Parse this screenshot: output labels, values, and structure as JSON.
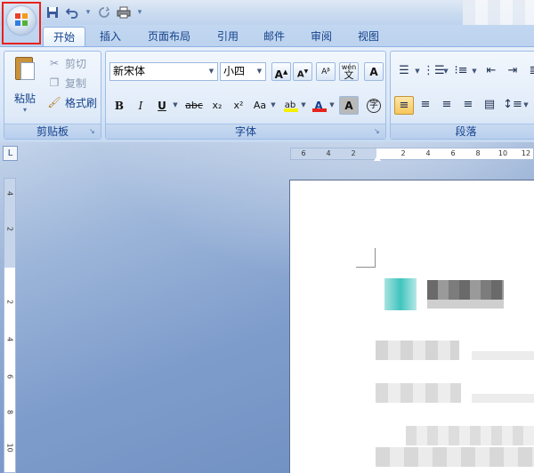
{
  "qat": {
    "icons": [
      "save-icon",
      "undo-icon",
      "redo-icon",
      "print-icon",
      "customize-icon"
    ]
  },
  "tabs": [
    {
      "label": "开始",
      "active": true
    },
    {
      "label": "插入"
    },
    {
      "label": "页面布局"
    },
    {
      "label": "引用"
    },
    {
      "label": "邮件"
    },
    {
      "label": "审阅"
    },
    {
      "label": "视图"
    }
  ],
  "clipboard": {
    "label": "剪贴板",
    "paste": "粘贴",
    "cut": "剪切",
    "copy": "复制",
    "format_painter": "格式刷"
  },
  "font": {
    "label": "字体",
    "family": "新宋体",
    "size": "小四",
    "grow": "A",
    "shrink": "A",
    "bold": "B",
    "italic": "I",
    "underline": "U",
    "strikethrough": "abc",
    "subscript": "x₂",
    "superscript": "x²",
    "change_case": "Aa",
    "highlight": "ab",
    "font_color": "A",
    "char_shading": "A",
    "enclose": "字",
    "pinyin": "wén",
    "pinyin_char": "文",
    "border": "A"
  },
  "paragraph": {
    "label": "段落"
  },
  "ruler": {
    "h_labels": [
      "6",
      "4",
      "2",
      "2",
      "4",
      "6",
      "8",
      "10",
      "12"
    ],
    "v_labels": [
      "4",
      "2",
      "2",
      "4",
      "6",
      "8",
      "10"
    ]
  },
  "colors": {
    "highlight": "#f5f000",
    "font_color": "#e8221e",
    "accent": "#15428b"
  }
}
